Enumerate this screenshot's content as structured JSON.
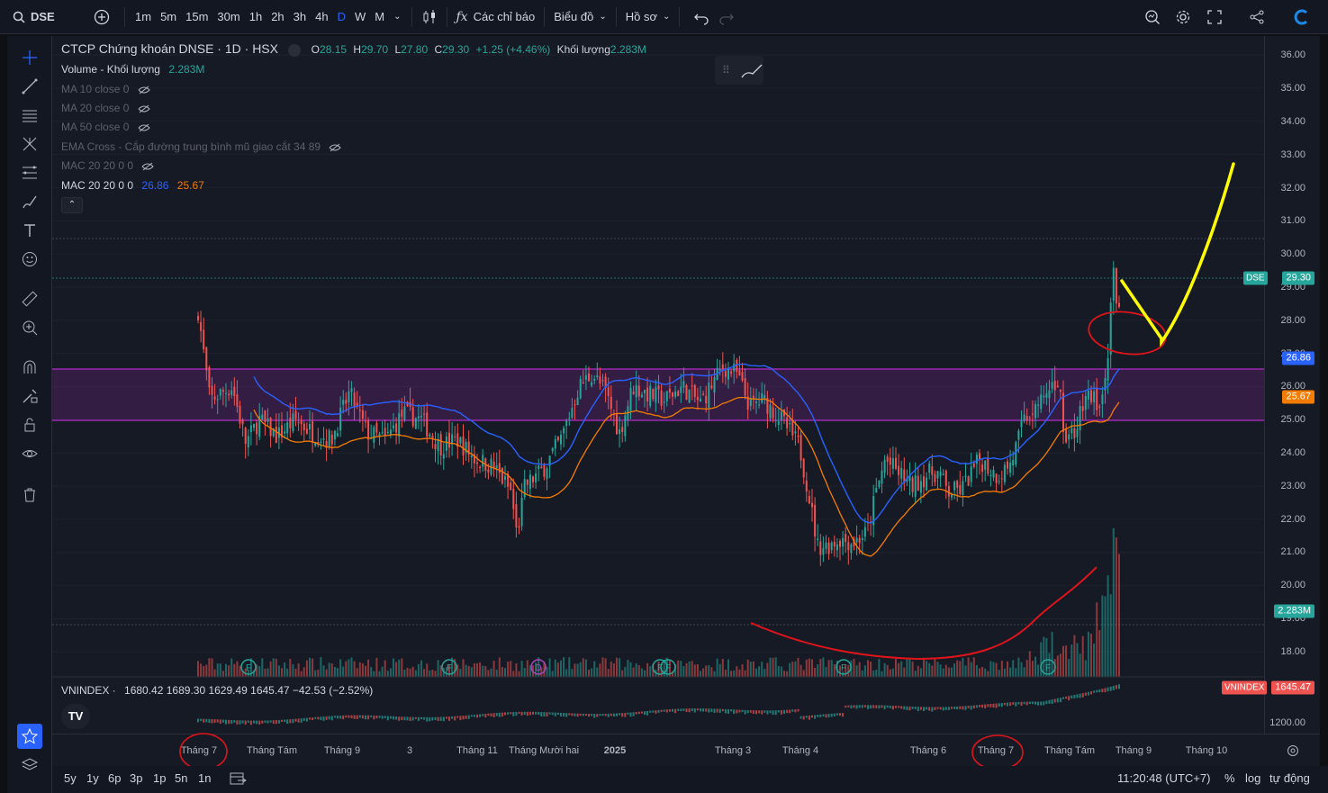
{
  "topbar": {
    "symbol": "DSE",
    "intervals": [
      "1m",
      "5m",
      "15m",
      "30m",
      "1h",
      "2h",
      "3h",
      "4h",
      "D",
      "W",
      "M"
    ],
    "active_interval": "D",
    "indicators_label": "Các chỉ báo",
    "chart_type_label": "Biểu đồ",
    "profile_label": "Hồ sơ"
  },
  "legend": {
    "title": "CTCP Chứng khoán DNSE · 1D · HSX",
    "ohlc": {
      "o_label": "O",
      "o": "28.15",
      "h_label": "H",
      "h": "29.70",
      "l_label": "L",
      "l": "27.80",
      "c_label": "C",
      "c": "29.30",
      "change": "+1.25 (+4.46%)"
    },
    "volume_label": "Khối lượng",
    "volume_value": "2.283M",
    "rows": [
      {
        "label": "Volume - Khối lượng",
        "value": "2.283M"
      },
      {
        "label": "MA 10 close 0"
      },
      {
        "label": "MA 20 close 0"
      },
      {
        "label": "MA 50 close 0"
      },
      {
        "label": "EMA Cross - Cắp đường trung bình mũ giao cắt 34 89"
      },
      {
        "label": "MAC 20 20 0 0"
      },
      {
        "label": "MAC 20 20 0 0",
        "v1": "26.86",
        "v2": "25.67"
      }
    ]
  },
  "price_axis": {
    "labels": [
      "36.00",
      "35.00",
      "34.00",
      "33.00",
      "32.00",
      "31.00",
      "30.00",
      "29.00",
      "28.00",
      "27.00",
      "26.00",
      "25.00",
      "24.00",
      "23.00",
      "22.00",
      "21.00",
      "20.00",
      "19.00",
      "18.00"
    ],
    "last_price": "29.30",
    "last_price_name": "DSE",
    "mac_upper": "26.86",
    "mac_lower": "25.67",
    "volume_badge": "2.283M",
    "index_value": "1645.47",
    "index_name": "VNINDEX",
    "index_axis_label": "1200.00"
  },
  "index_legend": {
    "name": "VNINDEX ·",
    "values": "1680.42  1689.30  1629.49  1645.47  −42.53 (−2.52%)"
  },
  "time_axis": [
    "Tháng 7",
    "Tháng Tám",
    "Tháng 9",
    "3",
    "Tháng 11",
    "Tháng Mười hai",
    "2025",
    "Tháng 3",
    "Tháng 4",
    "Tháng 6",
    "Tháng 7",
    "Tháng Tám",
    "Tháng 9",
    "Tháng 10"
  ],
  "bottombar": {
    "ranges": [
      "5y",
      "1y",
      "6p",
      "3p",
      "1p",
      "5n",
      "1n"
    ],
    "clock": "11:20:48 (UTC+7)",
    "percent": "%",
    "log": "log",
    "auto": "tự động"
  },
  "colors": {
    "up": "#26a69a",
    "down": "#ef5350",
    "zone": "#9c27b0",
    "mac_upper": "#2962ff",
    "mac_lower": "#f57c00",
    "annot_red": "#e0141a",
    "annot_yellow": "#ffff00"
  }
}
